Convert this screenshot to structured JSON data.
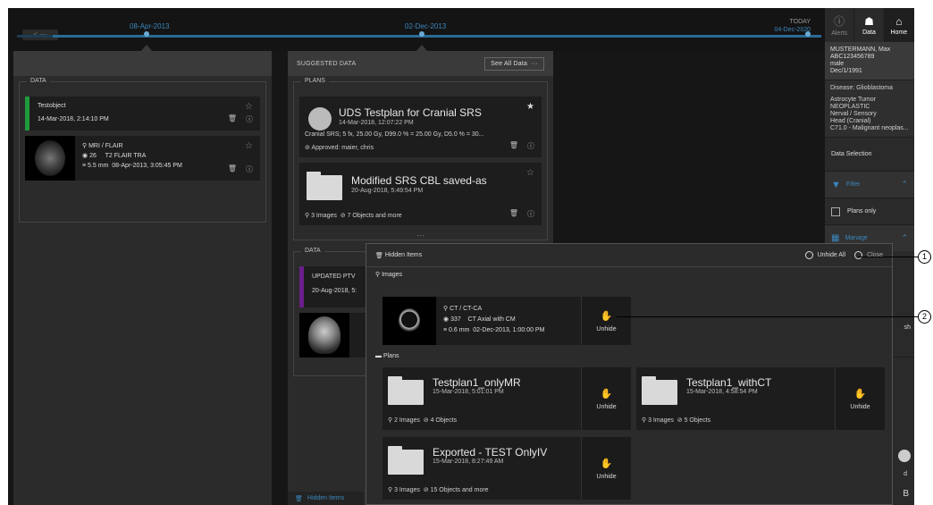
{
  "timeline": {
    "date1": "08-Apr-2013",
    "date2": "02-Dec-2013",
    "today_label": "TODAY",
    "today_date": "04-Dec-2020"
  },
  "nav": {
    "alerts": "Alerts",
    "data": "Data",
    "home": "Home"
  },
  "patient": {
    "name": "MUSTERMANN, Max",
    "id": "ABC123456789",
    "sex": "male",
    "dob": "Dec/1/1991"
  },
  "disease": {
    "title": "Disease:  Glioblastoma",
    "line1": "Astrocyte Tumor",
    "line2": "NEOPLASTIC",
    "line3": "Nerval / Sensory",
    "line4": "Head (Cranial)",
    "line5": "C71.0 - Malignant neoplas..."
  },
  "sidebar": {
    "data_selection": "Data Selection",
    "filter": "Filter",
    "plans_only": "Plans only",
    "manage": "Manage",
    "partial1": "sh",
    "partial2": "d",
    "partial3": "B"
  },
  "col1": {
    "group_label": "DATA",
    "item1_title": "Testobject",
    "item1_date": "14-Mar-2018, 2:14:10 PM",
    "item2_modality": "MRI / FLAIR",
    "item2_count": "26",
    "item2_series": "T2 FLAIR TRA",
    "item2_slice": "5.5 mm",
    "item2_date": "08-Apr-2013, 3:05:45 PM"
  },
  "col2": {
    "header": "SUGGESTED DATA",
    "see_all": "See All Data",
    "plans_label": "PLANS",
    "plan1_title": "UDS Testplan for Cranial SRS",
    "plan1_date": "14-Mar-2018, 12:07:22 PM",
    "plan1_desc": "Cranial SRS; 5 fx, 25.00 Gy, D99.0 % = 25.00 Gy, D5.0 % = 30...",
    "plan1_approved": "Approved:  maier, chris",
    "plan2_title": "Modified SRS CBL saved-as",
    "plan2_date": "20-Aug-2018, 5:49:54 PM",
    "plan2_meta": "3 Images",
    "plan2_meta2": "7 Objects and more",
    "data_label": "DATA",
    "data1_title": "UPDATED PTV",
    "data1_date": "20-Aug-2018, 5:",
    "hidden_items_tab": "Hidden Items"
  },
  "overlay": {
    "title": "Hidden Items",
    "unhide_all": "Unhide All",
    "close": "Close",
    "images_label": "Images",
    "image1_modality": "CT / CT-CA",
    "image1_count": "337",
    "image1_series": "CT Axial with CM",
    "image1_slice": "0.6 mm",
    "image1_date": "02-Dec-2013, 1:00:00 PM",
    "plans_label": "Plans",
    "unhide": "Unhide",
    "plan1_title": "Testplan1_onlyMR",
    "plan1_date": "15-Mar-2018, 5:01:01 PM",
    "plan1_images": "2 Images",
    "plan1_objects": "4 Objects",
    "plan2_title": "Testplan1_withCT",
    "plan2_date": "15-Mar-2018, 4:58:54 PM",
    "plan2_images": "3 Images",
    "plan2_objects": "5 Objects",
    "plan3_title": "Exported - TEST OnlyIV",
    "plan3_date": "15-Mar-2018, 8:27:49 AM",
    "plan3_images": "3 Images",
    "plan3_objects": "15 Objects and more"
  },
  "callouts": {
    "c1": "1",
    "c2": "2"
  },
  "colors": {
    "accent": "#3b87bd",
    "green_bar": "#1f9a3c",
    "purple_bar": "#6a1f8a"
  }
}
